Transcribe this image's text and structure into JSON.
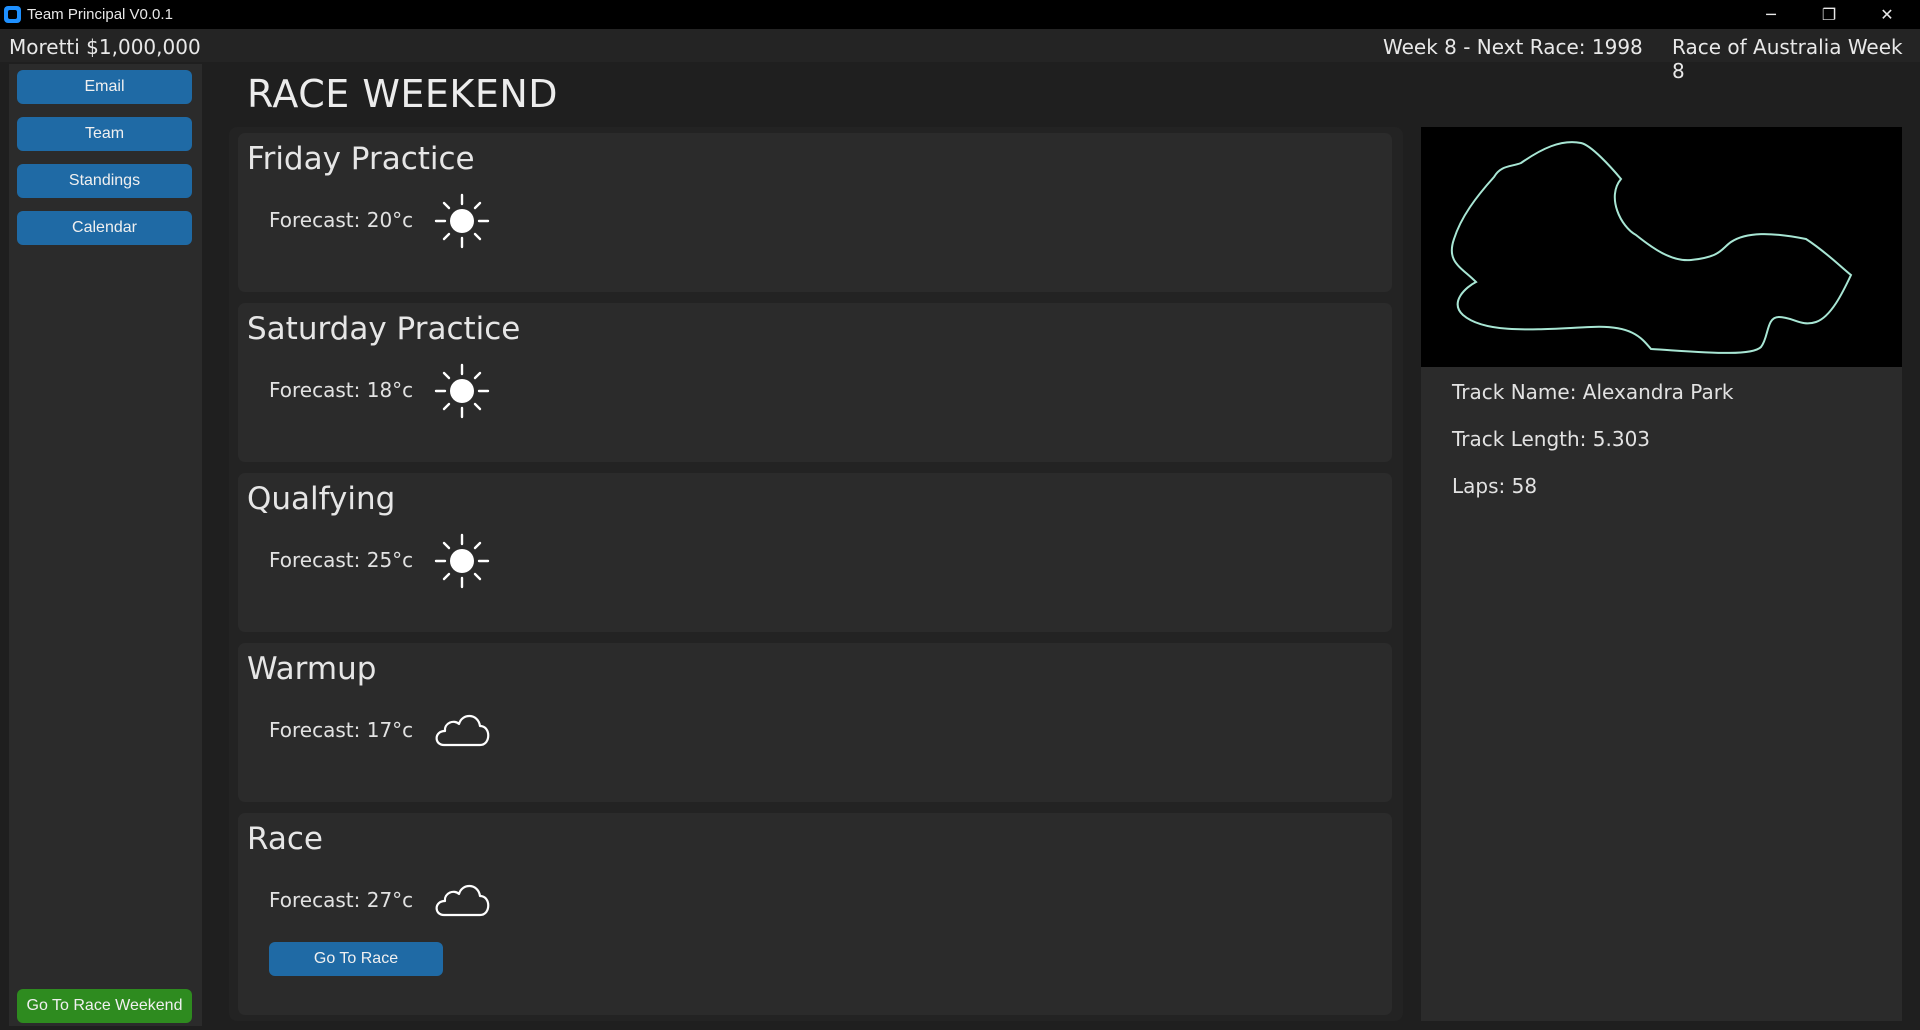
{
  "window": {
    "title": "Team Principal V0.0.1",
    "controls": {
      "minimize": "─",
      "maximize": "❐",
      "close": "✕"
    }
  },
  "topbar": {
    "player": "Moretti $1,000,000",
    "week": "Week 8 - Next Race: 1998",
    "race": "Race of Australia Week 8"
  },
  "sidebar": {
    "items": [
      {
        "label": "Email"
      },
      {
        "label": "Team"
      },
      {
        "label": "Standings"
      },
      {
        "label": "Calendar"
      }
    ],
    "bottom_button": "Go To Race Weekend"
  },
  "page": {
    "title": "RACE WEEKEND"
  },
  "sessions": [
    {
      "name": "Friday Practice",
      "forecast": "Forecast: 20°c",
      "weather_icon": "sun-icon"
    },
    {
      "name": "Saturday Practice",
      "forecast": "Forecast: 18°c",
      "weather_icon": "sun-icon"
    },
    {
      "name": "Qualfying",
      "forecast": "Forecast: 25°c",
      "weather_icon": "sun-icon"
    },
    {
      "name": "Warmup",
      "forecast": "Forecast: 17°c",
      "weather_icon": "cloud-icon"
    },
    {
      "name": "Race",
      "forecast": "Forecast: 27°c",
      "weather_icon": "cloud-icon"
    }
  ],
  "race_button": "Go To Race",
  "track": {
    "name": "Track Name: Alexandra Park",
    "length": "Track Length: 5.303",
    "laps": "Laps: 58",
    "outline_color": "#a8e6d4"
  },
  "colors": {
    "button_blue": "#1f6aa5",
    "button_green": "#2e8b1f",
    "panel": "#2b2b2b",
    "background": "#1f1f1f"
  }
}
